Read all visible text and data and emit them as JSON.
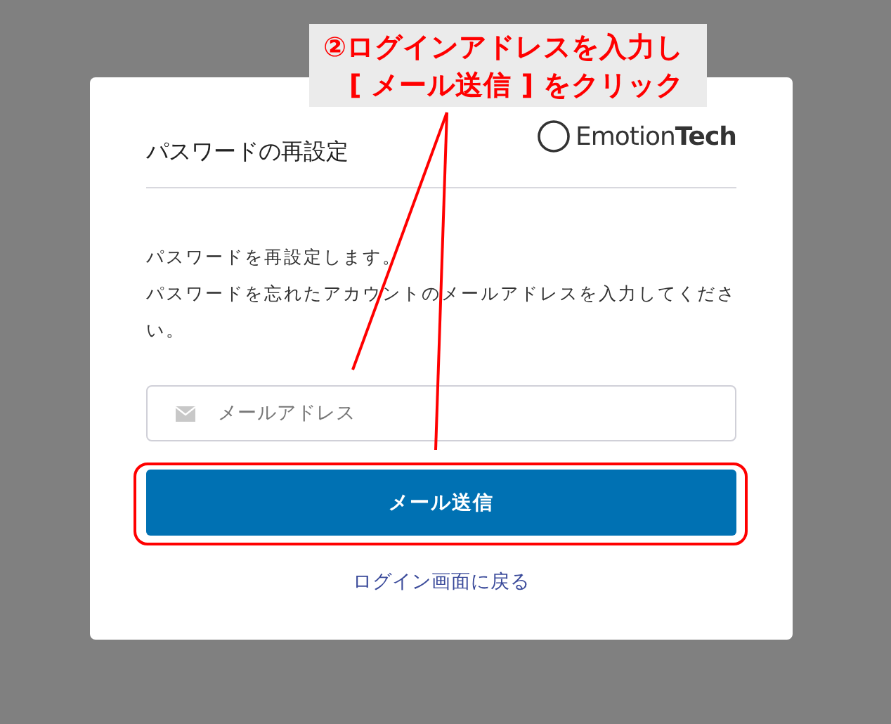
{
  "card": {
    "title": "パスワードの再設定",
    "logo": "Emotion**Tech**",
    "messages": [
      "パスワードを再設定します。",
      "パスワードを忘れたアカウントのメールアドレスを入力してください。"
    ],
    "email_field": {
      "placeholder": "メールアドレス"
    },
    "submit_button": {
      "label": "メール送信",
      "highlighted": true
    },
    "back_link": "ログイン画面に戻る"
  },
  "annotation": {
    "lines": [
      "②ログインアドレスを入力し",
      "[ メール送信 ] をクリック"
    ]
  }
}
